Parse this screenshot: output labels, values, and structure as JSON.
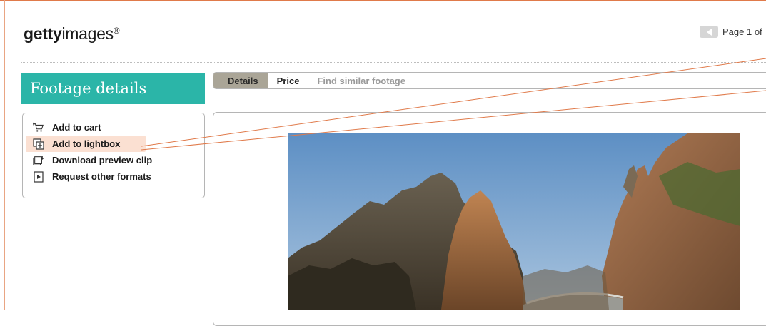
{
  "header": {
    "logo_bold": "getty",
    "logo_regular": "images",
    "logo_mark": "®",
    "pager_text": "Page 1 of"
  },
  "sidebar": {
    "title": "Footage details",
    "actions": [
      {
        "label": "Add to cart",
        "icon": "cart-icon"
      },
      {
        "label": "Add to lightbox",
        "icon": "lightbox-icon",
        "highlighted": true
      },
      {
        "label": "Download preview clip",
        "icon": "download-icon"
      },
      {
        "label": "Request other formats",
        "icon": "film-icon"
      }
    ]
  },
  "tabs": [
    {
      "label": "Details",
      "active": true
    },
    {
      "label": "Price"
    },
    {
      "label": "Find similar footage",
      "muted": true
    }
  ],
  "preview": {
    "description_icon": "footage-preview-image"
  },
  "colors": {
    "brand_teal": "#2bb5a8",
    "annotation": "#e07a4a",
    "highlight": "#fbe0d2",
    "active_tab": "#aaa597"
  }
}
